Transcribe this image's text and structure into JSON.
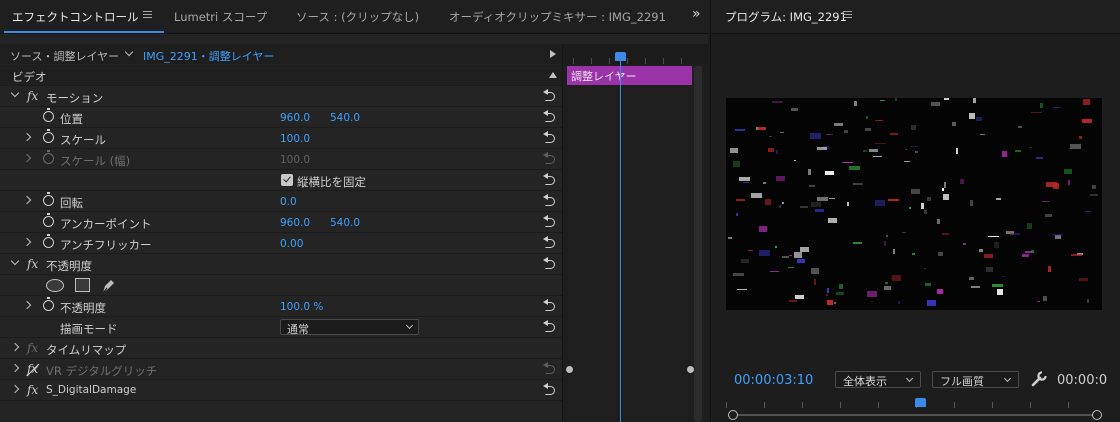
{
  "left_tabs": [
    {
      "label": "エフェクトコントロール",
      "active": true
    },
    {
      "label": "Lumetri スコープ",
      "active": false
    },
    {
      "label": "ソース : (クリップなし)",
      "active": false
    },
    {
      "label": "オーディオクリップミキサー : IMG_2291",
      "active": false
    }
  ],
  "overflow_label": "»",
  "source_bar": {
    "source": "ソース・調整レイヤー",
    "sequence": "IMG_2291・調整レイヤー"
  },
  "section_video": "ビデオ",
  "effects": {
    "motion": {
      "name": "モーション",
      "position": {
        "label": "位置",
        "x": "960.0",
        "y": "540.0"
      },
      "scale": {
        "label": "スケール",
        "value": "100.0"
      },
      "scale_width": {
        "label": "スケール (幅)",
        "value": "100.0"
      },
      "uniform_scale": {
        "label": "縦横比を固定",
        "checked": true
      },
      "rotation": {
        "label": "回転",
        "value": "0.0"
      },
      "anchor": {
        "label": "アンカーポイント",
        "x": "960.0",
        "y": "540.0"
      },
      "anti_flicker": {
        "label": "アンチフリッカー",
        "value": "0.00"
      }
    },
    "opacity": {
      "name": "不透明度",
      "opacity": {
        "label": "不透明度",
        "value": "100.0 %"
      },
      "blend_mode": {
        "label": "描画モード",
        "value": "通常"
      }
    },
    "time_remap": {
      "name": "タイムリマップ"
    },
    "vr_glitch": {
      "name": "VR デジタルグリッチ"
    },
    "digital_damage": {
      "name": "S_DigitalDamage"
    }
  },
  "mini_timeline": {
    "clip_label": "調整レイヤー",
    "clip_color": "#9b33a8"
  },
  "program": {
    "title": "プログラム: IMG_2291",
    "timecode": "00:00:03:10",
    "zoom": "全体表示",
    "quality": "フル画質",
    "duration_partial": "00:00:0"
  },
  "colors": {
    "accent": "#3b8ae6",
    "value_blue": "#3ea0ff"
  }
}
